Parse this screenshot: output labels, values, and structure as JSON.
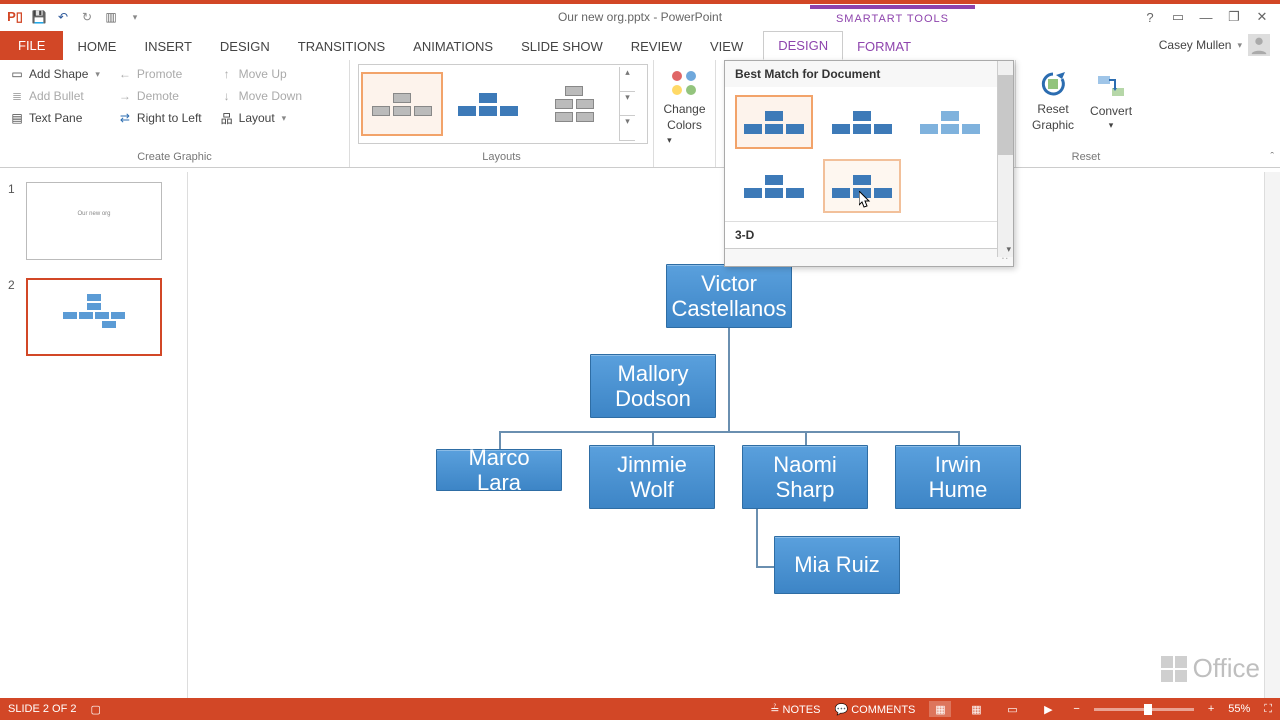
{
  "app": {
    "title": "Our new org.pptx - PowerPoint",
    "contextTools": "SMARTART TOOLS"
  },
  "user": {
    "name": "Casey Mullen"
  },
  "winctrls": {
    "help": "?",
    "opts": "▭",
    "min": "—",
    "restore": "❐",
    "close": "✕"
  },
  "tabs": {
    "file": "FILE",
    "home": "HOME",
    "insert": "INSERT",
    "design": "DESIGN",
    "transitions": "TRANSITIONS",
    "animations": "ANIMATIONS",
    "slideshow": "SLIDE SHOW",
    "review": "REVIEW",
    "view": "VIEW",
    "stDesign": "DESIGN",
    "stFormat": "FORMAT"
  },
  "ribbon": {
    "createGraphic": {
      "addShape": "Add Shape",
      "addBullet": "Add Bullet",
      "textPane": "Text Pane",
      "promote": "Promote",
      "demote": "Demote",
      "rtl": "Right to Left",
      "moveUp": "Move Up",
      "moveDown": "Move Down",
      "layout": "Layout",
      "label": "Create Graphic"
    },
    "layouts": {
      "label": "Layouts"
    },
    "changeColors": {
      "line1": "Change",
      "line2": "Colors"
    },
    "reset": {
      "reset1": "Reset",
      "reset2": "Graphic",
      "convert": "Convert",
      "label": "Reset"
    }
  },
  "stylesPanel": {
    "bestMatch": "Best Match for Document",
    "threeD": "3-D"
  },
  "slides": {
    "s1num": "1",
    "s2num": "2",
    "s1title": "Our new org"
  },
  "org": {
    "n1": "Victor Castellanos",
    "n2": "Mallory Dodson",
    "n3": "Marco Lara",
    "n4": "Jimmie Wolf",
    "n5": "Naomi Sharp",
    "n6": "Irwin Hume",
    "n7": "Mia Ruiz"
  },
  "status": {
    "slideInfo": "SLIDE 2 OF 2",
    "notes": "NOTES",
    "comments": "COMMENTS",
    "zoom": "55%"
  },
  "office": "Office"
}
